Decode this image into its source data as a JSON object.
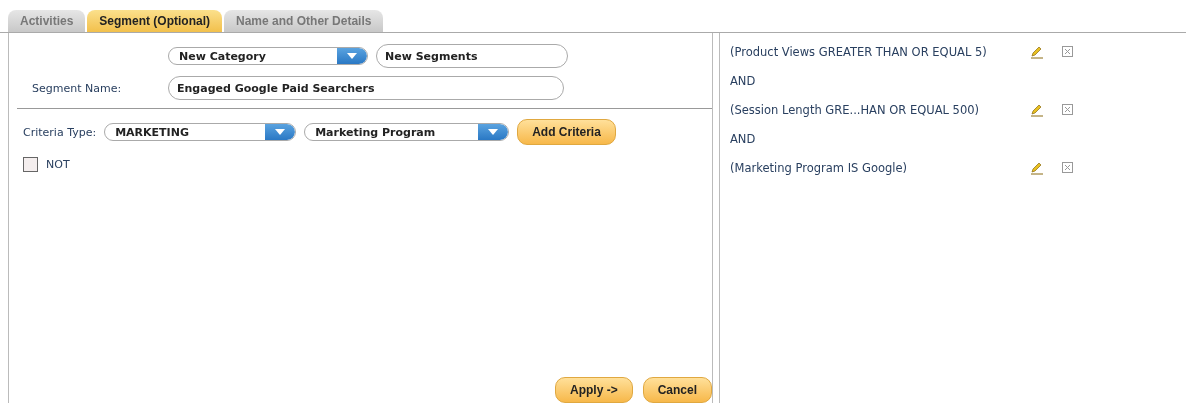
{
  "tabs": [
    {
      "label": "Activities",
      "selected": false
    },
    {
      "label": "Segment (Optional)",
      "selected": true
    },
    {
      "label": "Name and Other Details",
      "selected": false
    }
  ],
  "category": {
    "dropdown": "New Category",
    "field": "New Segments"
  },
  "segment_name": {
    "label": "Segment Name:",
    "value": "Engaged Google Paid Searchers"
  },
  "criteria": {
    "label": "Criteria Type:",
    "type_dropdown": "MARKETING",
    "field_dropdown": "Marketing Program",
    "add_button": "Add Criteria"
  },
  "not_checkbox": {
    "label": "NOT",
    "checked": false
  },
  "buttons": [
    {
      "label": "Apply ->"
    },
    {
      "label": "Cancel"
    }
  ],
  "conditions": [
    {
      "kind": "criterion",
      "text": "(Product Views GREATER THAN OR EQUAL 5)"
    },
    {
      "kind": "operator",
      "text": "AND"
    },
    {
      "kind": "criterion",
      "text": "(Session Length GRE...HAN OR EQUAL 500)"
    },
    {
      "kind": "operator",
      "text": "AND"
    },
    {
      "kind": "criterion",
      "text": "(Marketing Program IS Google)"
    }
  ]
}
